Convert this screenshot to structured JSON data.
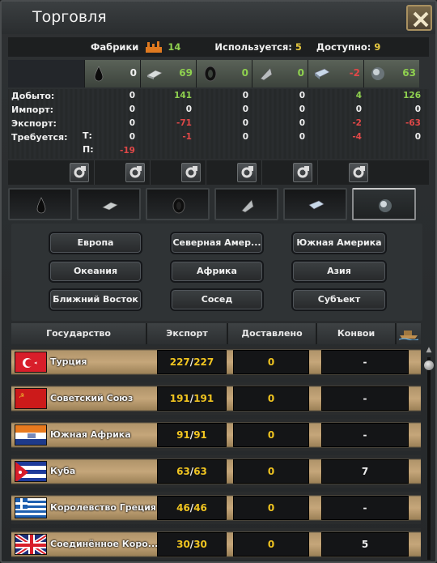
{
  "window": {
    "title": "Торговля"
  },
  "factory_bar": {
    "factories_label": "Фабрики",
    "factories_value": "14",
    "used_label": "Используется:",
    "used_value": "5",
    "available_label": "Доступно:",
    "available_value": "9"
  },
  "resources": {
    "columns": [
      {
        "icon": "oil-drop-icon",
        "header": "0",
        "header_color": "#f0f0f0"
      },
      {
        "icon": "aluminium-ingot-icon",
        "header": "69",
        "header_color": "#8fd14f"
      },
      {
        "icon": "rubber-tire-icon",
        "header": "0",
        "header_color": "#8fd14f"
      },
      {
        "icon": "tungsten-icon",
        "header": "0",
        "header_color": "#8fd14f"
      },
      {
        "icon": "steel-ingot-icon",
        "header": "-2",
        "header_color": "#e04848"
      },
      {
        "icon": "chromium-orb-icon",
        "header": "63",
        "header_color": "#8fd14f"
      }
    ],
    "row_labels": [
      "Добыто:",
      "Импорт:",
      "Экспорт:",
      "Требуется:"
    ],
    "t_label": "Т:",
    "p_label": "П:",
    "cells": [
      [
        "0",
        "0",
        "0",
        "0",
        "-19"
      ],
      [
        "141",
        "0",
        "-71",
        "-1",
        ""
      ],
      [
        "0",
        "0",
        "0",
        "0",
        ""
      ],
      [
        "0",
        "0",
        "0",
        "0",
        ""
      ],
      [
        "4",
        "0",
        "-2",
        "-4",
        ""
      ],
      [
        "126",
        "0",
        "-63",
        "0",
        ""
      ]
    ]
  },
  "tabs": [
    {
      "icon": "oil-drop-icon"
    },
    {
      "icon": "aluminium-ingot-icon"
    },
    {
      "icon": "rubber-tire-icon"
    },
    {
      "icon": "tungsten-icon"
    },
    {
      "icon": "steel-ingot-icon"
    },
    {
      "icon": "chromium-orb-icon",
      "active": true
    }
  ],
  "regions": {
    "europe": "Европа",
    "north_america": "Северная Амер...",
    "south_america": "Южная Америка",
    "oceania": "Океания",
    "africa": "Африка",
    "asia": "Азия",
    "middle_east": "Ближний Восток",
    "neighbor": "Сосед",
    "subject": "Субъект"
  },
  "table": {
    "headers": {
      "country": "Государство",
      "export": "Экспорт",
      "delivered": "Доставлено",
      "convoys": "Конвои"
    },
    "rows": [
      {
        "country": "Турция",
        "flag": "turkey",
        "export_avail": "227",
        "export_total": "227",
        "delivered": "0",
        "convoys": "-"
      },
      {
        "country": "Советский Союз",
        "flag": "soviet",
        "export_avail": "191",
        "export_total": "191",
        "delivered": "0",
        "convoys": "-"
      },
      {
        "country": "Южная Африка",
        "flag": "south-africa",
        "export_avail": "91",
        "export_total": "91",
        "delivered": "0",
        "convoys": "-"
      },
      {
        "country": "Куба",
        "flag": "cuba",
        "export_avail": "63",
        "export_total": "63",
        "delivered": "0",
        "convoys": "7"
      },
      {
        "country": "Королевство Греция",
        "flag": "greece",
        "export_avail": "46",
        "export_total": "46",
        "delivered": "0",
        "convoys": "-"
      },
      {
        "country": "Соединённое Коро...",
        "flag": "uk",
        "export_avail": "30",
        "export_total": "30",
        "delivered": "0",
        "convoys": "5"
      }
    ]
  }
}
